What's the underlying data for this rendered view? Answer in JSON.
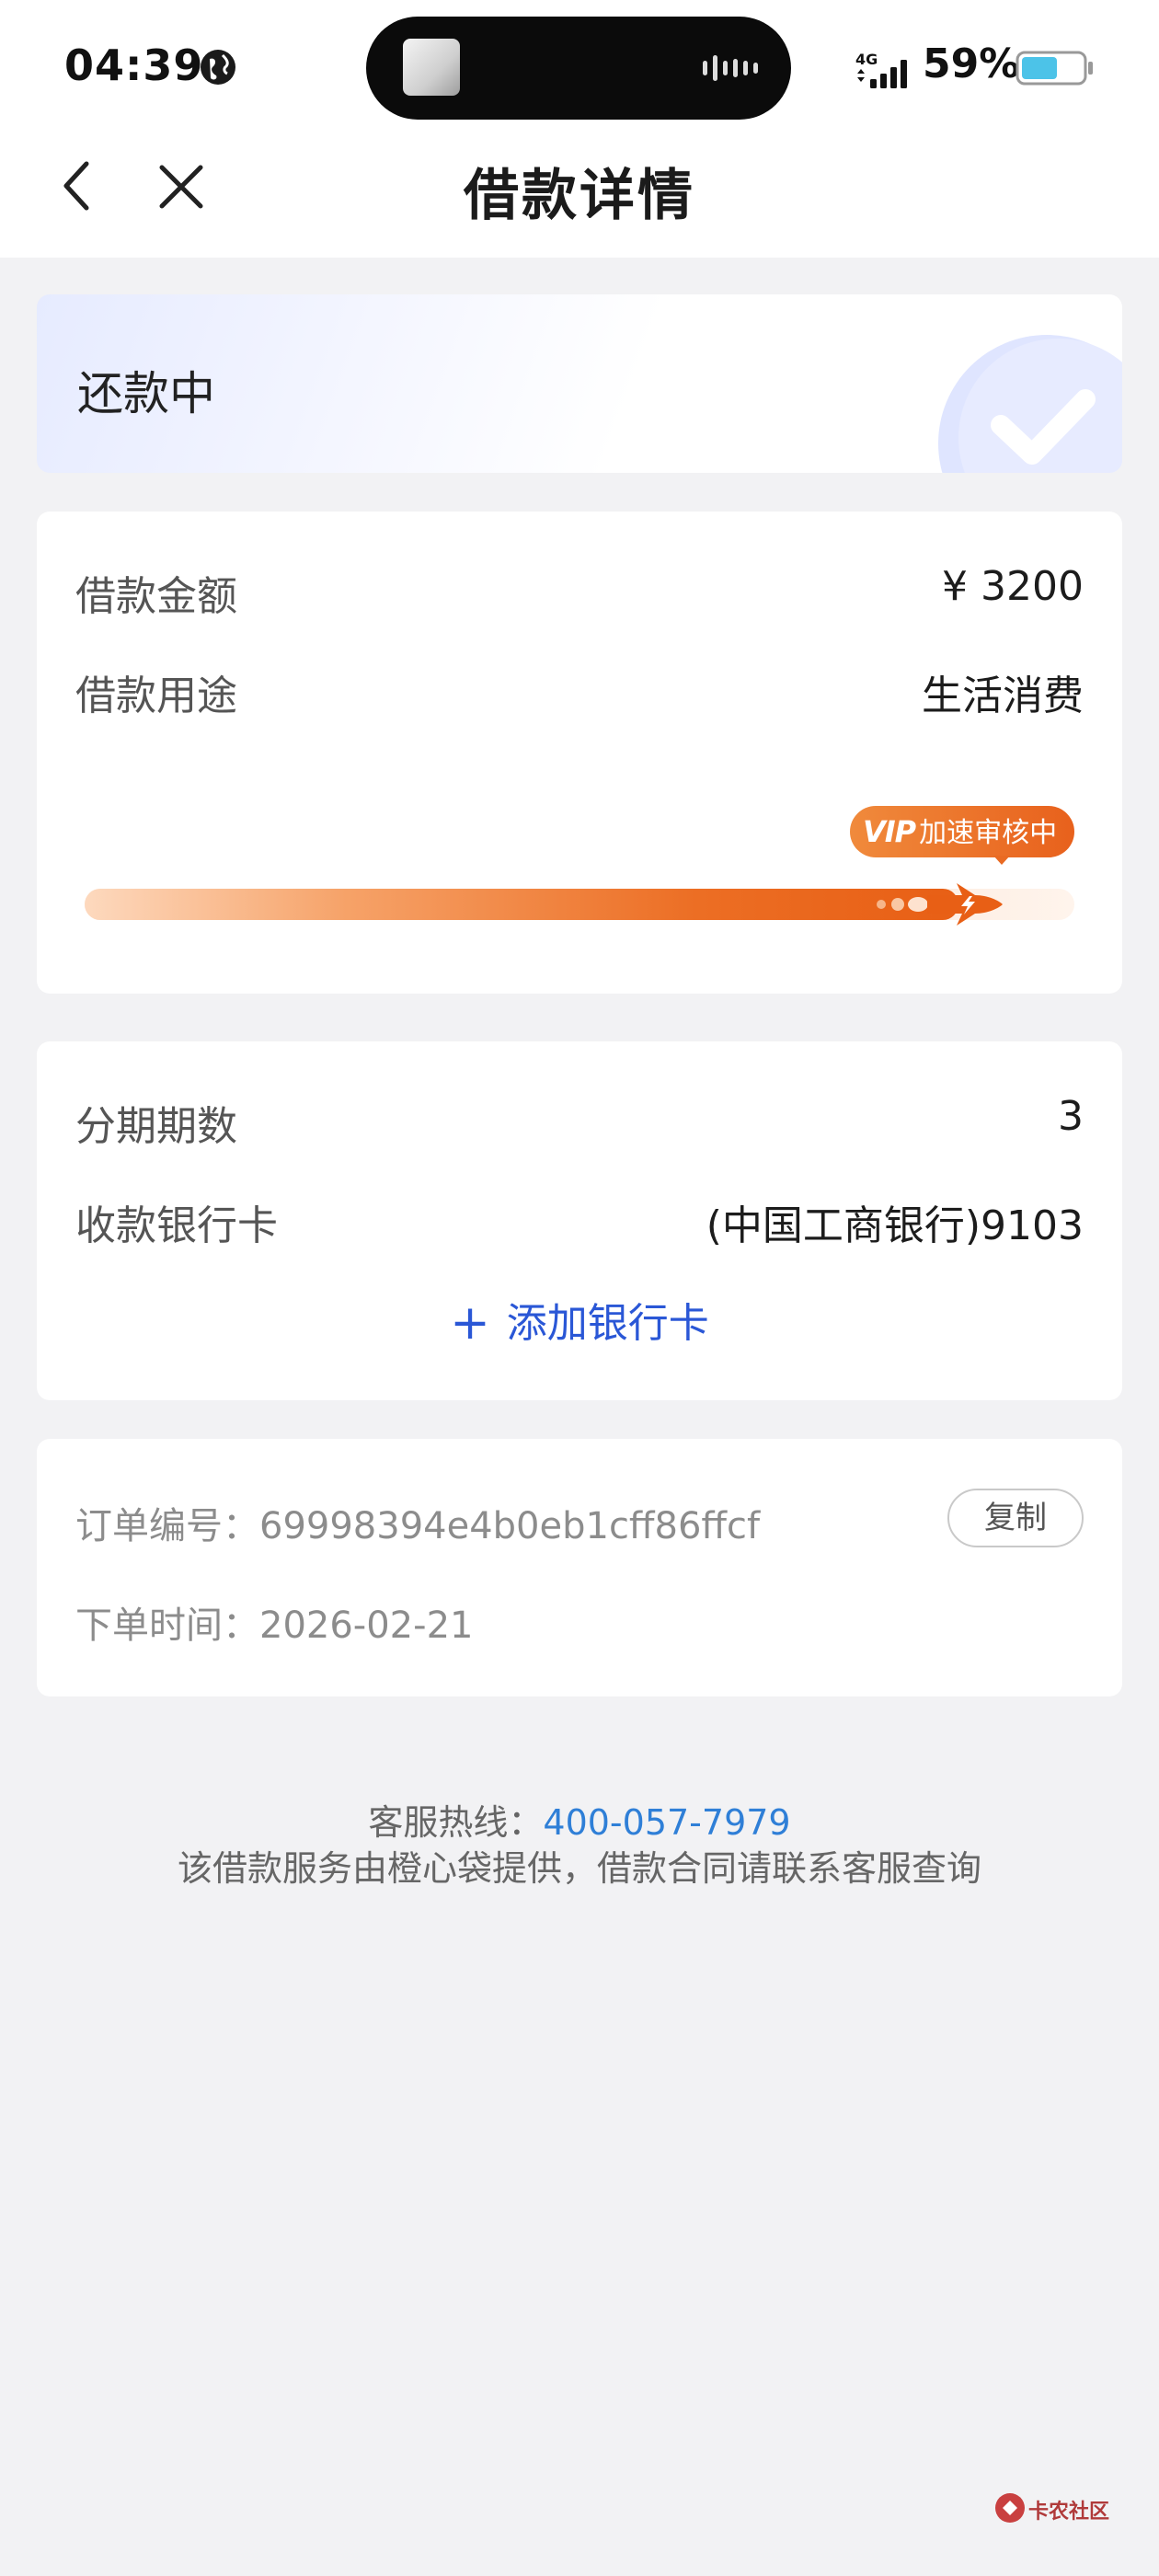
{
  "status_bar": {
    "time": "04:39",
    "network": "4G",
    "battery": "59%",
    "battery_level": 0.59
  },
  "header": {
    "title": "借款详情"
  },
  "loan_status": {
    "text": "还款中"
  },
  "loan_info": {
    "amount_label": "借款金额",
    "amount_value": "¥ 3200",
    "purpose_label": "借款用途",
    "purpose_value": "生活消费",
    "vip_logo": "VIP",
    "vip_badge": "加速审核中",
    "progress": 0.92
  },
  "installment": {
    "periods_label": "分期期数",
    "periods_value": "3",
    "bank_label": "收款银行卡",
    "bank_value": "(中国工商银行)9103",
    "add_card": "添加银行卡"
  },
  "order": {
    "number_label": "订单编号：",
    "number_value": "69998394e4b0eb1cff86ffcf",
    "copy": "复制",
    "time_label": "下单时间：",
    "time_value": "2026-02-21"
  },
  "footer": {
    "hotline_label": "客服热线：",
    "hotline_number": "400-057-7979",
    "notice": "该借款服务由橙心袋提供，借款合同请联系客服查询"
  },
  "watermark": {
    "text": "卡农社区"
  },
  "colors": {
    "accent_blue": "#2a57d6",
    "progress_orange": "#e85f15",
    "hotline_blue": "#2f7fd7"
  }
}
